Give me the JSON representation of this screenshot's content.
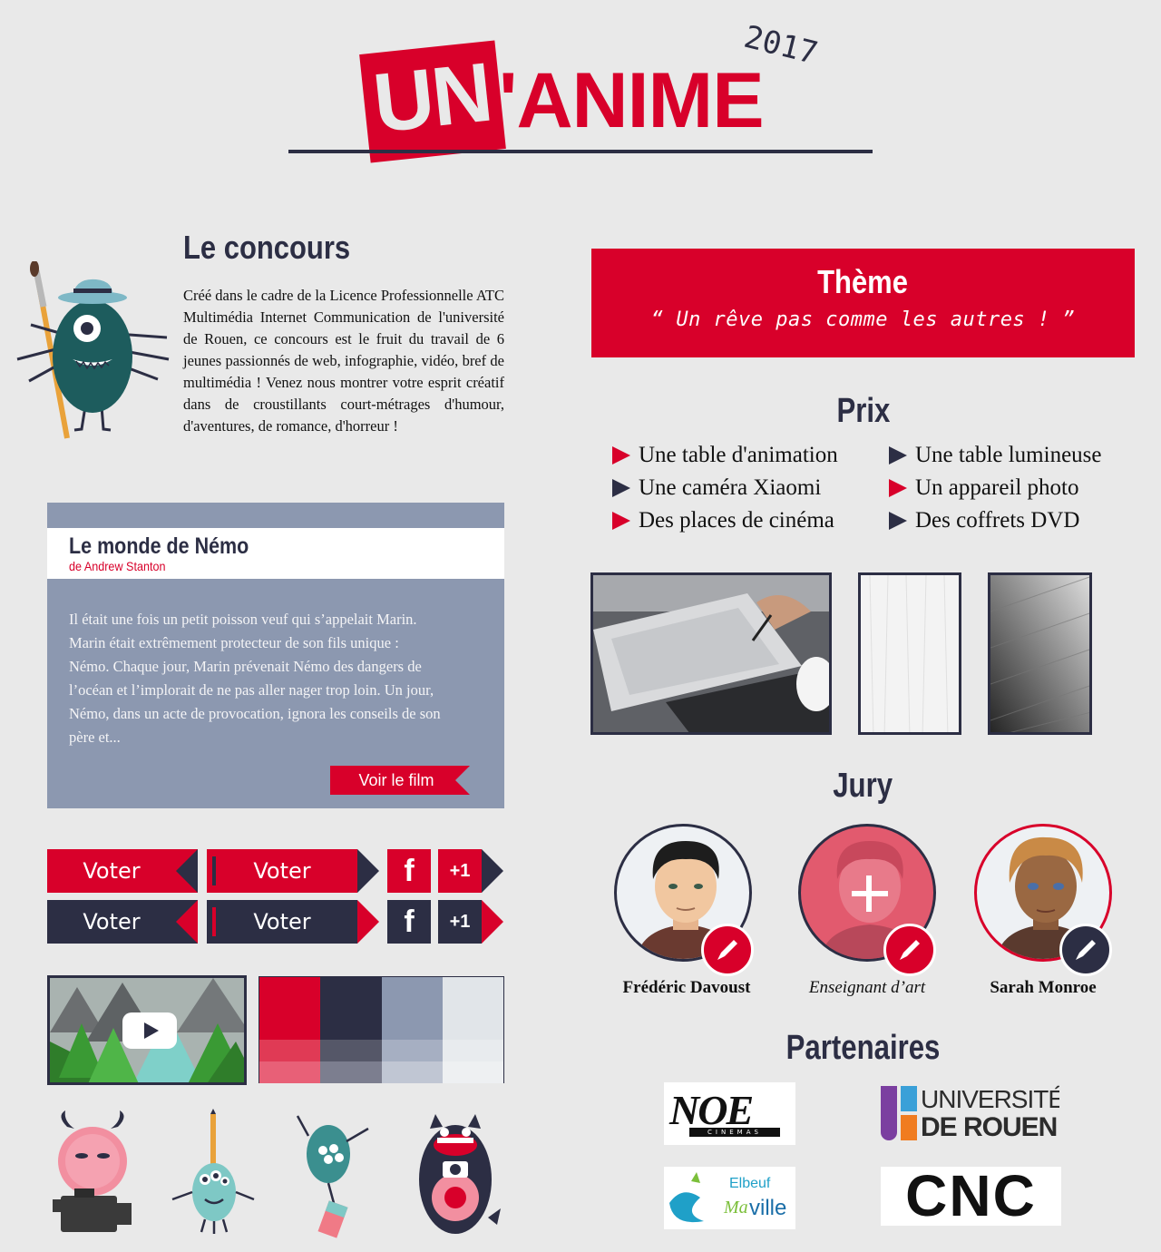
{
  "header": {
    "logo_un": "UN",
    "logo_anime": "'ANIME",
    "logo_year": "2017"
  },
  "concours": {
    "title": "Le concours",
    "text": "Créé dans le cadre de la Licence Professionnelle ATC Multimédia Internet Communication de l'université de Rouen, ce concours est le fruit du travail de 6 jeunes passionnés de web, infographie, vidéo, bref de multimédia ! Venez nous montrer votre esprit créatif dans de croustillants court-métrages d'humour, d'aventures, de romance, d'horreur !"
  },
  "film": {
    "title": "Le monde de Némo",
    "author": "de Andrew Stanton",
    "synopsis": "Il était une fois un petit poisson veuf qui s’appelait Marin. Marin était extrêmement protecteur de son fils unique : Némo. Chaque jour, Marin prévenait Némo des dangers de l’océan et l’implorait de ne pas aller nager trop loin. Un jour, Némo, dans un acte de provocation, ignora les conseils de son père et...",
    "button": "Voir le film"
  },
  "vote": {
    "label": "Voter",
    "facebook": "f",
    "plus": "+1"
  },
  "theme": {
    "title": "Thème",
    "quote": "“ Un rêve pas comme les autres ! ”"
  },
  "prix": {
    "title": "Prix",
    "items": [
      "Une table d'animation",
      "Une table lumineuse",
      "Une caméra Xiaomi",
      "Un appareil photo",
      "Des places de cinéma",
      "Des coffrets DVD"
    ]
  },
  "jury": {
    "title": "Jury",
    "members": [
      "Frédéric Davoust",
      "Enseignant d’art",
      "Sarah Monroe"
    ]
  },
  "partenaires": {
    "title": "Partenaires",
    "noe": "NOE",
    "noe_sub": "CINEMAS",
    "univ_line1": "UNIVERSITÉ",
    "univ_line2": "DE ROUEN",
    "elbeuf_1": "Elbeuf",
    "elbeuf_2": "Ma",
    "elbeuf_3": "ville",
    "cnc": "CNC"
  },
  "colors": {
    "red": "#d8002a",
    "navy": "#2c2e44",
    "slate": "#8c98b0",
    "light": "#e1e5e9"
  }
}
